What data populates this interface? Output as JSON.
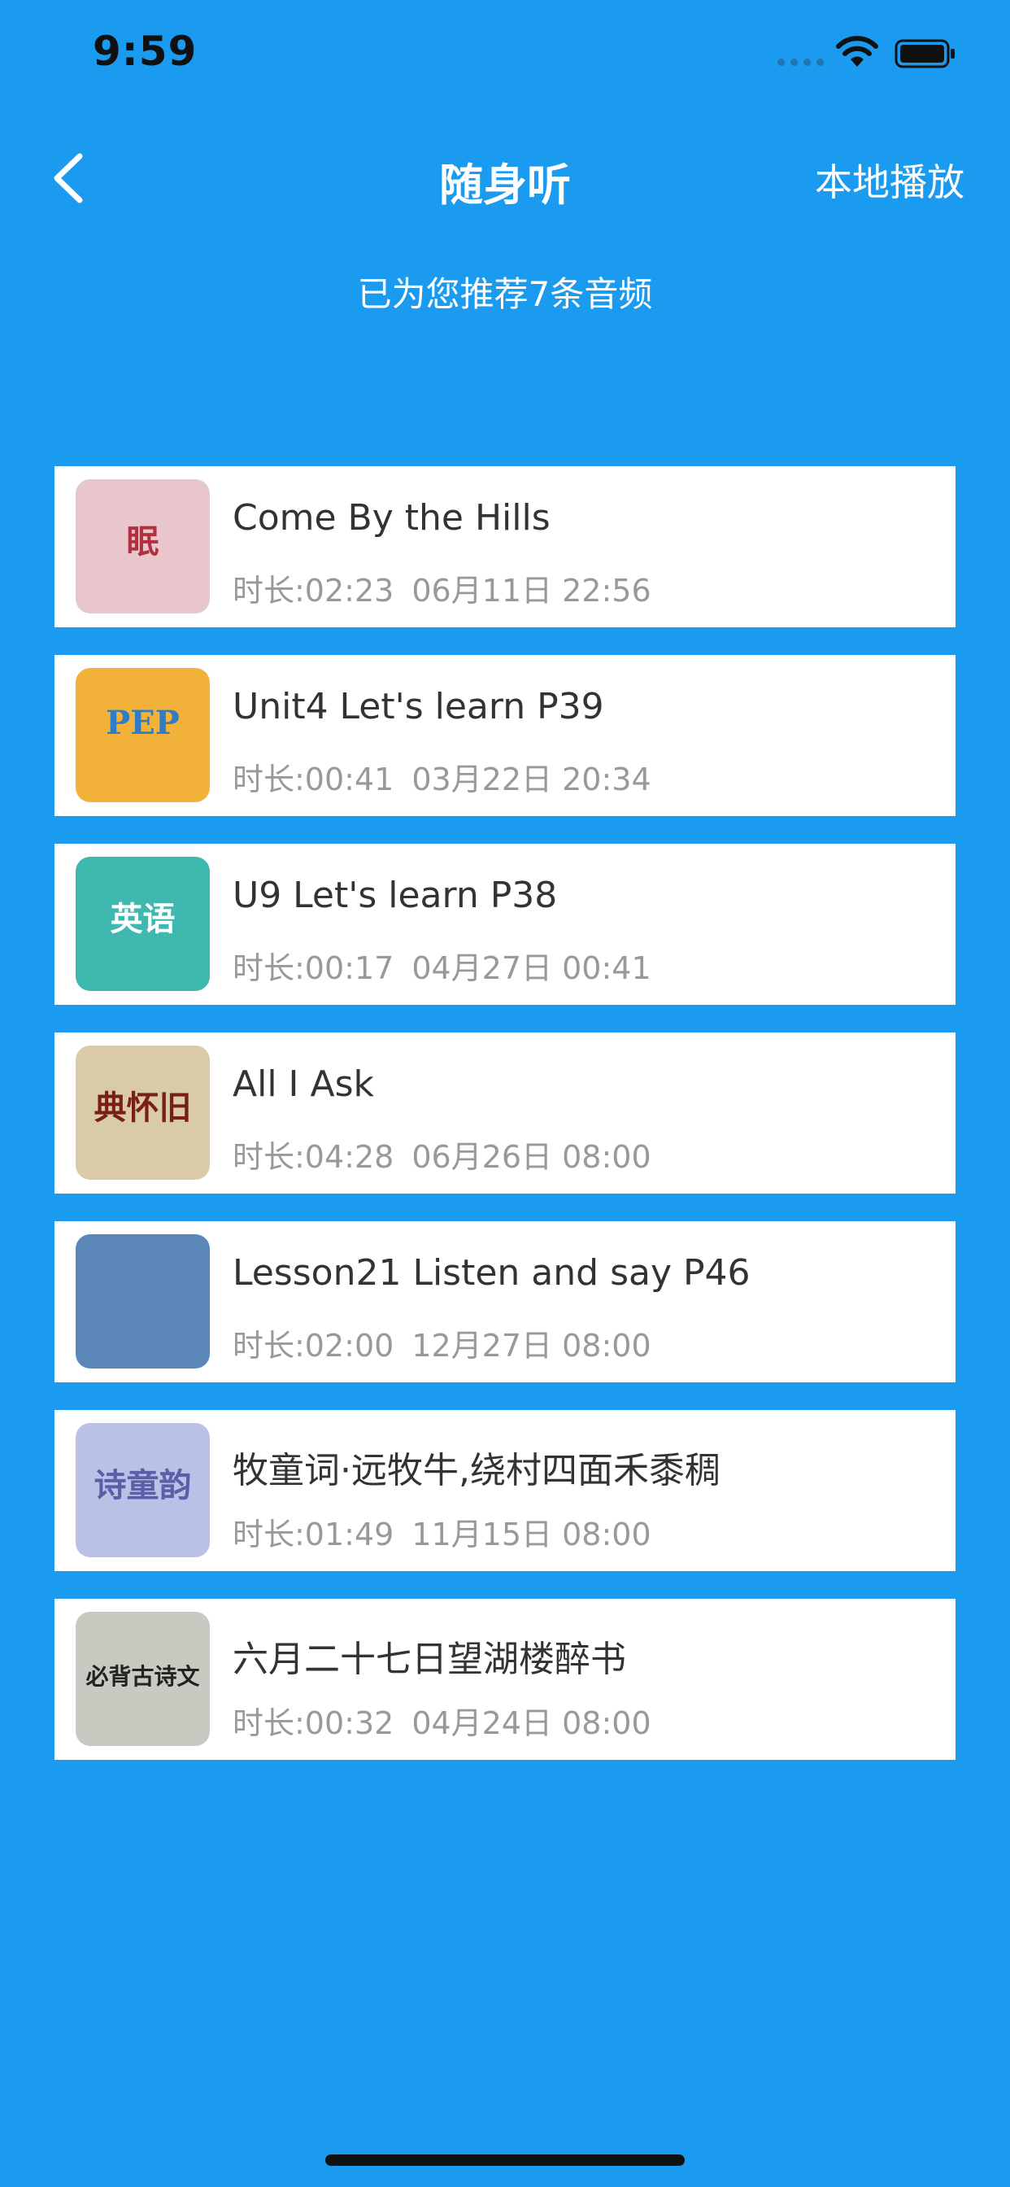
{
  "status_bar": {
    "time": "9:59"
  },
  "nav": {
    "title": "随身听",
    "right_action": "本地播放"
  },
  "subtitle": "已为您推荐7条音频",
  "items": [
    {
      "title": "Come By the Hills",
      "duration": "时长:02:23",
      "date": "06月11日 22:56",
      "thumb_text": "眠",
      "thumb_bg": "#E8C6CC",
      "thumb_fg": "#B23040"
    },
    {
      "title": "Unit4 Let's learn P39",
      "duration": "时长:00:41",
      "date": "03月22日 20:34",
      "thumb_text": "PEP",
      "thumb_bg": "#F2B23A",
      "thumb_fg": "#2E7DC6"
    },
    {
      "title": "U9 Let's learn P38",
      "duration": "时长:00:17",
      "date": "04月27日 00:41",
      "thumb_text": "英语",
      "thumb_bg": "#3FB8B0",
      "thumb_fg": "#FFFFFF"
    },
    {
      "title": "All I Ask",
      "duration": "时长:04:28",
      "date": "06月26日 08:00",
      "thumb_text": "典怀旧",
      "thumb_bg": "#D9CBA8",
      "thumb_fg": "#7A1E18"
    },
    {
      "title": "Lesson21 Listen and say P46",
      "duration": "时长:02:00",
      "date": "12月27日 08:00",
      "thumb_text": "",
      "thumb_bg": "#5B86B8",
      "thumb_fg": "#FFFFFF"
    },
    {
      "title": "牧童词·远牧牛,绕村四面禾黍稠",
      "duration": "时长:01:49",
      "date": "11月15日 08:00",
      "thumb_text": "诗童韵",
      "thumb_bg": "#B9C2E6",
      "thumb_fg": "#5A5FA8"
    },
    {
      "title": "六月二十七日望湖楼醉书",
      "duration": "时长:00:32",
      "date": "04月24日 08:00",
      "thumb_text": "必背古诗文",
      "thumb_bg": "#C9C9C2",
      "thumb_fg": "#222222"
    }
  ]
}
